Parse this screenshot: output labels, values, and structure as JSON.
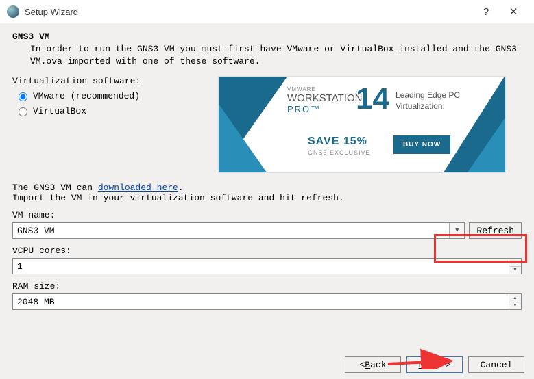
{
  "window": {
    "title": "Setup Wizard"
  },
  "page": {
    "heading": "GNS3 VM",
    "description": "In order to run the GNS3 VM you must first have VMware or VirtualBox installed and the GNS3 VM.ova imported with one of these software."
  },
  "virtualization": {
    "label": "Virtualization software:",
    "options": [
      {
        "label": "VMware (recommended)",
        "selected": true
      },
      {
        "label": "VirtualBox",
        "selected": false
      }
    ]
  },
  "banner": {
    "vendor": "VMWARE",
    "product": "WORKSTATION",
    "edition": "PRO™",
    "version": "14",
    "tagline1": "Leading Edge PC",
    "tagline2": "Virtualization.",
    "save": "SAVE 15%",
    "save_sub": "GNS3 EXCLUSIVE",
    "buy": "BUY NOW"
  },
  "download": {
    "prefix": "The GNS3 VM can ",
    "link_text": "downloaded here",
    "suffix": ".",
    "instruction": "Import the VM in your virtualization software and hit refresh."
  },
  "fields": {
    "vm_name_label": "VM name:",
    "vm_name_value": "GNS3 VM",
    "refresh_label": "Refresh",
    "vcpu_label": "vCPU cores:",
    "vcpu_value": "1",
    "ram_label": "RAM size:",
    "ram_value": "2048 MB"
  },
  "buttons": {
    "back": "< Back",
    "next": "Next >",
    "cancel": "Cancel"
  }
}
